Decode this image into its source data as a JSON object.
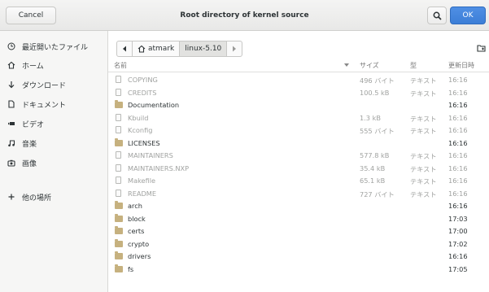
{
  "header": {
    "cancel_label": "Cancel",
    "title": "Root directory of kernel source",
    "ok_label": "OK",
    "search_icon": "search-icon"
  },
  "sidebar": {
    "items": [
      {
        "icon": "clock-icon",
        "label": "最近開いたファイル"
      },
      {
        "icon": "home-icon",
        "label": "ホーム"
      },
      {
        "icon": "download-icon",
        "label": "ダウンロード"
      },
      {
        "icon": "document-icon",
        "label": "ドキュメント"
      },
      {
        "icon": "video-icon",
        "label": "ビデオ"
      },
      {
        "icon": "music-icon",
        "label": "音楽"
      },
      {
        "icon": "camera-icon",
        "label": "画像"
      },
      {
        "icon": "plus-icon",
        "label": "他の場所"
      }
    ]
  },
  "pathbar": {
    "crumbs": [
      "atmark",
      "linux-5.10"
    ]
  },
  "columns": {
    "name": "名前",
    "size": "サイズ",
    "type": "型",
    "modified": "更新日時"
  },
  "files": [
    {
      "name": "COPYING",
      "kind": "file",
      "size": "496 バイト",
      "type": "テキスト",
      "modified": "16:16"
    },
    {
      "name": "CREDITS",
      "kind": "file",
      "size": "100.5 kB",
      "type": "テキスト",
      "modified": "16:16"
    },
    {
      "name": "Documentation",
      "kind": "folder",
      "size": "",
      "type": "",
      "modified": "16:16"
    },
    {
      "name": "Kbuild",
      "kind": "file",
      "size": "1.3 kB",
      "type": "テキスト",
      "modified": "16:16"
    },
    {
      "name": "Kconfig",
      "kind": "file",
      "size": "555 バイト",
      "type": "テキスト",
      "modified": "16:16"
    },
    {
      "name": "LICENSES",
      "kind": "folder",
      "size": "",
      "type": "",
      "modified": "16:16"
    },
    {
      "name": "MAINTAINERS",
      "kind": "file",
      "size": "577.8 kB",
      "type": "テキスト",
      "modified": "16:16"
    },
    {
      "name": "MAINTAINERS.NXP",
      "kind": "file",
      "size": "35.4 kB",
      "type": "テキスト",
      "modified": "16:16"
    },
    {
      "name": "Makefile",
      "kind": "file",
      "size": "65.1 kB",
      "type": "テキスト",
      "modified": "16:16"
    },
    {
      "name": "README",
      "kind": "file",
      "size": "727 バイト",
      "type": "テキスト",
      "modified": "16:16"
    },
    {
      "name": "arch",
      "kind": "folder",
      "size": "",
      "type": "",
      "modified": "16:16"
    },
    {
      "name": "block",
      "kind": "folder",
      "size": "",
      "type": "",
      "modified": "17:03"
    },
    {
      "name": "certs",
      "kind": "folder",
      "size": "",
      "type": "",
      "modified": "17:00"
    },
    {
      "name": "crypto",
      "kind": "folder",
      "size": "",
      "type": "",
      "modified": "17:02"
    },
    {
      "name": "drivers",
      "kind": "folder",
      "size": "",
      "type": "",
      "modified": "16:16"
    },
    {
      "name": "fs",
      "kind": "folder",
      "size": "",
      "type": "",
      "modified": "17:05"
    }
  ]
}
